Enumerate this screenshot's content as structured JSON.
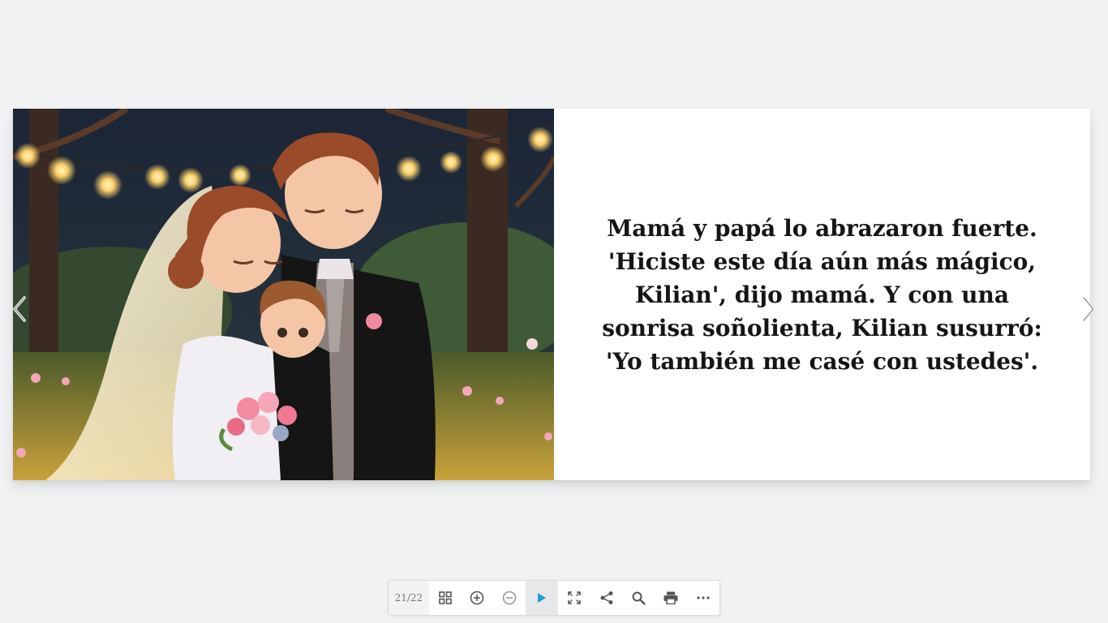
{
  "viewer": {
    "page_indicator": "21/22"
  },
  "book": {
    "left_page": {
      "illustration": "wedding-family-illustration"
    },
    "right_page": {
      "lines": [
        "Mamá y papá lo abrazaron fuerte.",
        "'Hiciste este día aún más mágico,",
        "Kilian', dijo mamá. Y con una",
        "sonrisa soñolienta, Kilian susurró:",
        "'Yo también me casé con ustedes'."
      ]
    }
  },
  "navigation": {
    "prev_icon": "chevron-left-icon",
    "next_icon": "chevron-right-icon"
  },
  "toolbar": {
    "buttons": [
      {
        "icon": "grid-icon"
      },
      {
        "icon": "zoom-in-icon"
      },
      {
        "icon": "zoom-out-icon"
      },
      {
        "icon": "play-icon"
      },
      {
        "icon": "fullscreen-icon"
      },
      {
        "icon": "share-icon"
      },
      {
        "icon": "search-icon"
      },
      {
        "icon": "print-icon"
      },
      {
        "icon": "more-icon"
      }
    ],
    "accent_color": "#1a9ed8"
  }
}
